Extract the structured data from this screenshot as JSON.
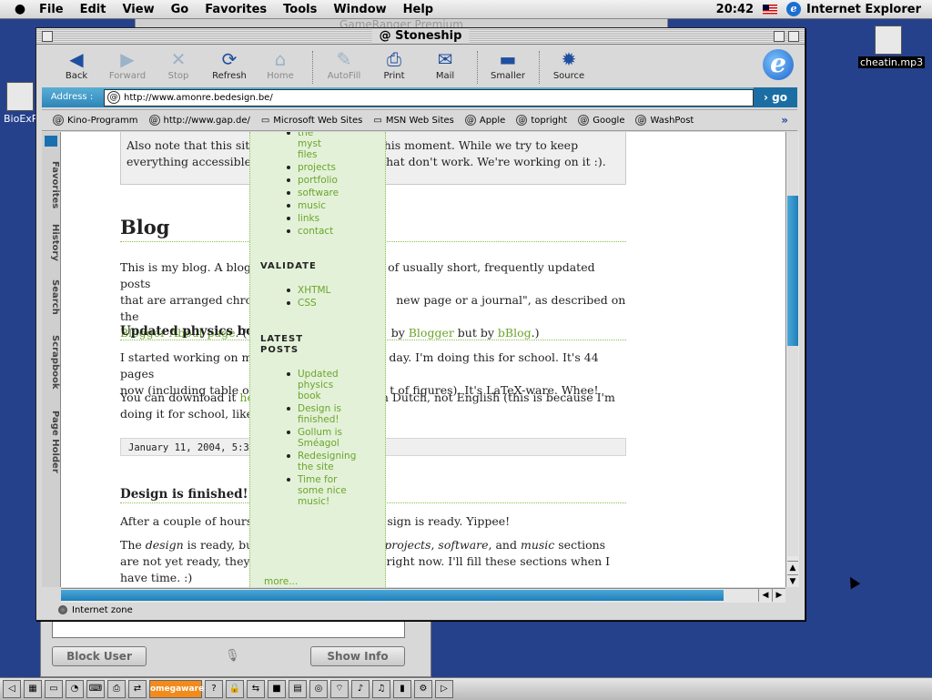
{
  "menubar": {
    "menus": [
      "File",
      "Edit",
      "View",
      "Go",
      "Favorites",
      "Tools",
      "Window",
      "Help"
    ],
    "clock": "20:42",
    "app_name": "Internet Explorer"
  },
  "background_windows": {
    "top_title": "GameRanger Premium",
    "block_user": "Block User",
    "show_info": "Show Info"
  },
  "desktop": {
    "left_icon": "BioExP",
    "right_icon": "cheatin.mp3"
  },
  "window": {
    "title": "Stoneship",
    "toolbar": [
      {
        "label": "Back",
        "icon": "◀",
        "enabled": true
      },
      {
        "label": "Forward",
        "icon": "▶",
        "enabled": false
      },
      {
        "label": "Stop",
        "icon": "✕",
        "enabled": false
      },
      {
        "label": "Refresh",
        "icon": "⟳",
        "enabled": true
      },
      {
        "label": "Home",
        "icon": "⌂",
        "enabled": false
      },
      {
        "label": "AutoFill",
        "icon": "✎",
        "enabled": false
      },
      {
        "label": "Print",
        "icon": "⎙",
        "enabled": true
      },
      {
        "label": "Mail",
        "icon": "✉",
        "enabled": true
      },
      {
        "label": "Smaller",
        "icon": "▬",
        "enabled": true
      },
      {
        "label": "Source",
        "icon": "✹",
        "enabled": true
      }
    ],
    "address_label": "Address :",
    "url": "http://www.amonre.bedesign.be/",
    "go_label": "go",
    "favorites": [
      {
        "label": "Kino-Programm",
        "icon": "@"
      },
      {
        "label": "http://www.gap.de/",
        "icon": "@"
      },
      {
        "label": "Microsoft Web Sites",
        "icon": "▭"
      },
      {
        "label": "MSN Web Sites",
        "icon": "▭"
      },
      {
        "label": "Apple",
        "icon": "@"
      },
      {
        "label": "topright",
        "icon": "@"
      },
      {
        "label": "Google",
        "icon": "@"
      },
      {
        "label": "WashPost",
        "icon": "@"
      }
    ],
    "more_favorites": "»",
    "side_tabs": [
      "Favorites",
      "History",
      "Search",
      "Scrapbook",
      "Page Holder"
    ],
    "status": "Internet zone"
  },
  "page": {
    "note_line1": "Also note that this site",
    "note_line1b": "his moment. While we try to keep",
    "note_line2": "everything accessible",
    "note_line2b": "hat don't work. We're working on it :).",
    "blog_heading": "Blog",
    "blog_p1_a": "This is my blog. A blog",
    "blog_p1_b": "of usually short, frequently updated posts",
    "blog_p1_c": "that are arranged chron",
    "blog_p1_d": "new page or a journal\", as described on the",
    "blog_p1_link1": "Blogger About page",
    "blog_p1_e": ". (T",
    "blog_p1_f": "by ",
    "blog_p1_link2": "Blogger",
    "blog_p1_g": " but by ",
    "blog_p1_link3": "bBlog",
    "blog_p1_h": ".)",
    "post1_title": "Updated physics book",
    "post1_p1_a": "I started working on m",
    "post1_p1_b": "day. I'm doing this for school. It's 44 pages",
    "post1_p1_c": "now (including table of",
    "post1_p1_d": "t of figures). It's LaTeX-ware. Whee!",
    "post1_p2_a": "You can download it ",
    "post1_p2_link": "he",
    "post1_p2_b": "n Dutch, not English (this is because I'm",
    "post1_p2_c": "doing it for school, like",
    "post1_date": "January 11, 2004, 5:39",
    "post2_title": "Design is finished!",
    "post2_p1_a": "After a couple of hours",
    "post2_p1_b": "sign is ready. Yippee!",
    "post2_p2_a": "The ",
    "post2_p2_em1": "design",
    "post2_p2_b": " is ready, bu",
    "post2_p2_em2": "projects",
    "post2_p2_c": ", ",
    "post2_p2_em3": "software",
    "post2_p2_d": ", and ",
    "post2_p2_em4": "music",
    "post2_p2_e": " sections",
    "post2_p2_f": "are not yet ready, they",
    "post2_p2_g": "right now. I'll fill these sections when I",
    "post2_p2_h": "have time. :)"
  },
  "sidebar": {
    "nav": [
      "the myst files",
      "projects",
      "portfolio",
      "software",
      "music",
      "links",
      "contact"
    ],
    "validate_heading": "VALIDATE",
    "validate": [
      "XHTML",
      "CSS"
    ],
    "latest_heading": "LATEST POSTS",
    "latest": [
      "Updated physics book",
      "Design is finished!",
      "Gollum is Sméagol",
      "Redesigning the site",
      "Time for some nice music!"
    ],
    "more": "more..."
  },
  "taskbar": {
    "omegaware": "omegaware"
  }
}
